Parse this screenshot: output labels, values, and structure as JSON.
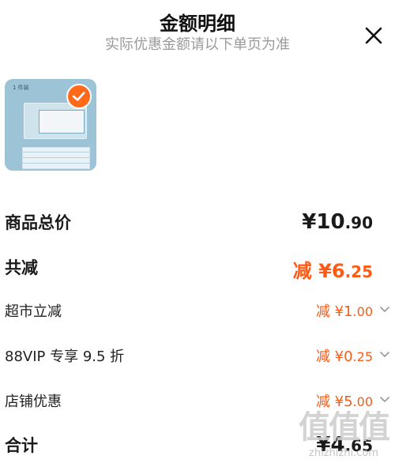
{
  "header": {
    "title": "金额明细",
    "subtitle": "实际优惠金额请以下单页为准"
  },
  "product": {
    "thumb_tag": "1 件装"
  },
  "rows": [
    {
      "label": "商品总价",
      "value": "¥10",
      "value_small": ".90",
      "style": "total"
    },
    {
      "label": "共减",
      "value": "减 ¥6",
      "value_small": ".25",
      "style": "discount-total"
    },
    {
      "label": "超市立减",
      "value": "减 ¥1",
      "value_small": ".00",
      "style": "discount"
    },
    {
      "label": "88VIP 专享 9.5 折",
      "value": "减 ¥0",
      "value_small": ".25",
      "style": "discount"
    },
    {
      "label": "店铺优惠",
      "value": "减 ¥5",
      "value_small": ".00",
      "style": "discount"
    },
    {
      "label": "合计",
      "value": "¥4",
      "value_small": ".65",
      "style": "total"
    }
  ],
  "watermark": {
    "glyph": "值值值",
    "site": "zhizhizhi.com"
  },
  "colors": {
    "accent": "#ff5a14",
    "check": "#ff6a1a",
    "subtitle": "#9a9a9a"
  }
}
